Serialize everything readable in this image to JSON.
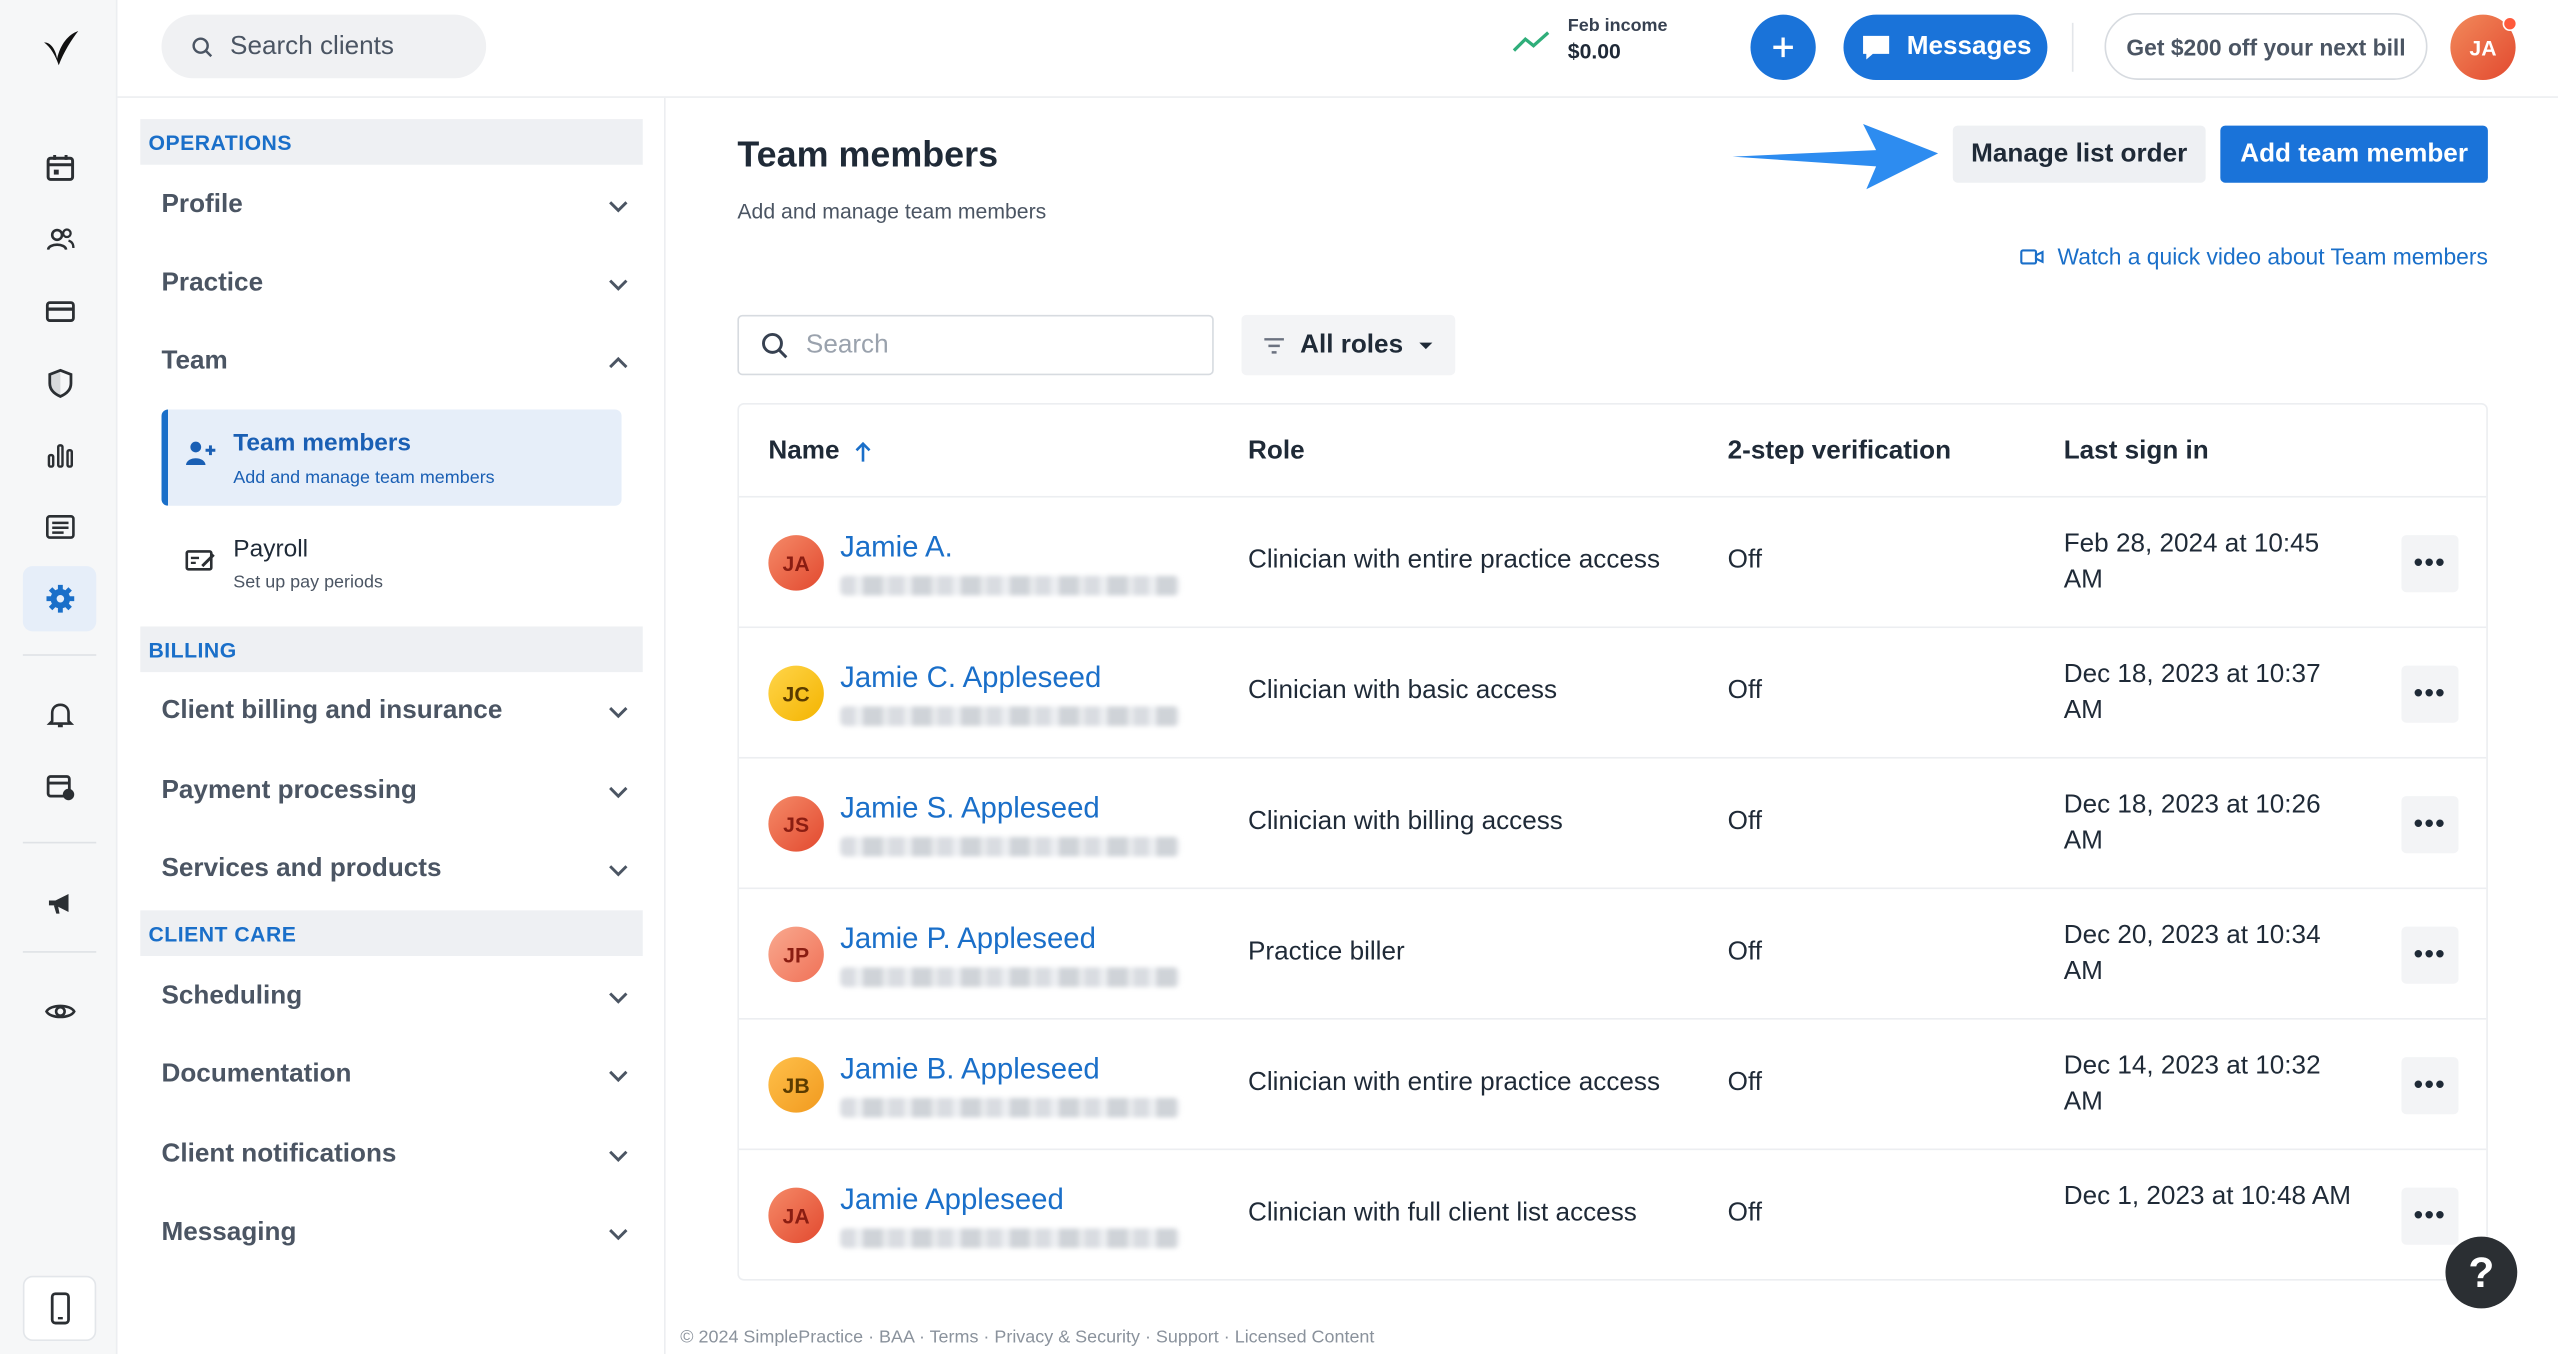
{
  "topbar": {
    "search_placeholder": "Search clients",
    "income_label": "Feb income",
    "income_value": "$0.00",
    "messages_label": "Messages",
    "promo_label": "Get $200 off your next bill",
    "avatar_initials": "JA"
  },
  "nav": {
    "operations": "OPERATIONS",
    "profile": "Profile",
    "practice": "Practice",
    "team": "Team",
    "team_members": "Team members",
    "team_members_sub": "Add and manage team members",
    "payroll": "Payroll",
    "payroll_sub": "Set up pay periods",
    "billing": "BILLING",
    "client_billing": "Client billing and insurance",
    "payment_processing": "Payment processing",
    "services_products": "Services and products",
    "client_care": "CLIENT CARE",
    "scheduling": "Scheduling",
    "documentation": "Documentation",
    "client_notifications": "Client notifications",
    "messaging": "Messaging"
  },
  "main": {
    "title": "Team members",
    "subtitle": "Add and manage team members",
    "manage_order": "Manage list order",
    "add_member": "Add team member",
    "video_link": "Watch a quick video about Team members",
    "search_placeholder": "Search",
    "roles_filter": "All roles",
    "columns": {
      "name": "Name",
      "role": "Role",
      "tsv": "2-step verification",
      "signin": "Last sign in"
    },
    "rows": [
      {
        "initials": "JA",
        "color": "red",
        "name": "Jamie A.",
        "role": "Clinician with entire practice access",
        "tsv": "Off",
        "signin": "Feb 28, 2024 at 10:45 AM"
      },
      {
        "initials": "JC",
        "color": "yellow",
        "name": "Jamie C. Appleseed",
        "role": "Clinician with basic access",
        "tsv": "Off",
        "signin": "Dec 18, 2023 at 10:37 AM"
      },
      {
        "initials": "JS",
        "color": "red",
        "name": "Jamie S. Appleseed",
        "role": "Clinician with billing access",
        "tsv": "Off",
        "signin": "Dec 18, 2023 at 10:26 AM"
      },
      {
        "initials": "JP",
        "color": "peach",
        "name": "Jamie P. Appleseed",
        "role": "Practice biller",
        "tsv": "Off",
        "signin": "Dec 20, 2023 at 10:34 AM"
      },
      {
        "initials": "JB",
        "color": "orange",
        "name": "Jamie B. Appleseed",
        "role": "Clinician with entire practice access",
        "tsv": "Off",
        "signin": "Dec 14, 2023 at 10:32 AM"
      },
      {
        "initials": "JA",
        "color": "red",
        "name": "Jamie Appleseed",
        "role": "Clinician with full client list access",
        "tsv": "Off",
        "signin": "Dec 1, 2023 at 10:48 AM"
      }
    ],
    "more_label": "•••"
  },
  "footer": "© 2024 SimplePractice · BAA · Terms · Privacy & Security · Support · Licensed Content",
  "help_label": "?",
  "colors": {
    "accent": "#1a73d9",
    "link": "#1a6fc9"
  }
}
